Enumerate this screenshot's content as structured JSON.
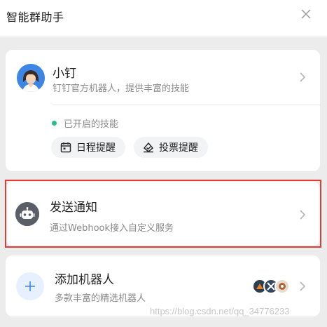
{
  "header": {
    "title": "智能群助手"
  },
  "bot_card": {
    "name": "小钉",
    "description": "钉钉官方机器人，提供丰富的技能",
    "status": "已开启的技能",
    "status_color": "#22c08a",
    "skills": [
      {
        "label": "日程提醒",
        "icon": "calendar-icon"
      },
      {
        "label": "投票提醒",
        "icon": "vote-icon"
      }
    ]
  },
  "notify_card": {
    "title": "发送通知",
    "description": "通过Webhook接入自定义服务",
    "icon": "robot-icon"
  },
  "add_card": {
    "title": "添加机器人",
    "description": "多款丰富的精选机器人",
    "icon": "plus-icon"
  },
  "watermark": "https://blog.csdn.net/qq_34776233",
  "colors": {
    "accent": "#3e86e6",
    "highlight_border": "#e63a33",
    "background": "#ececed"
  }
}
